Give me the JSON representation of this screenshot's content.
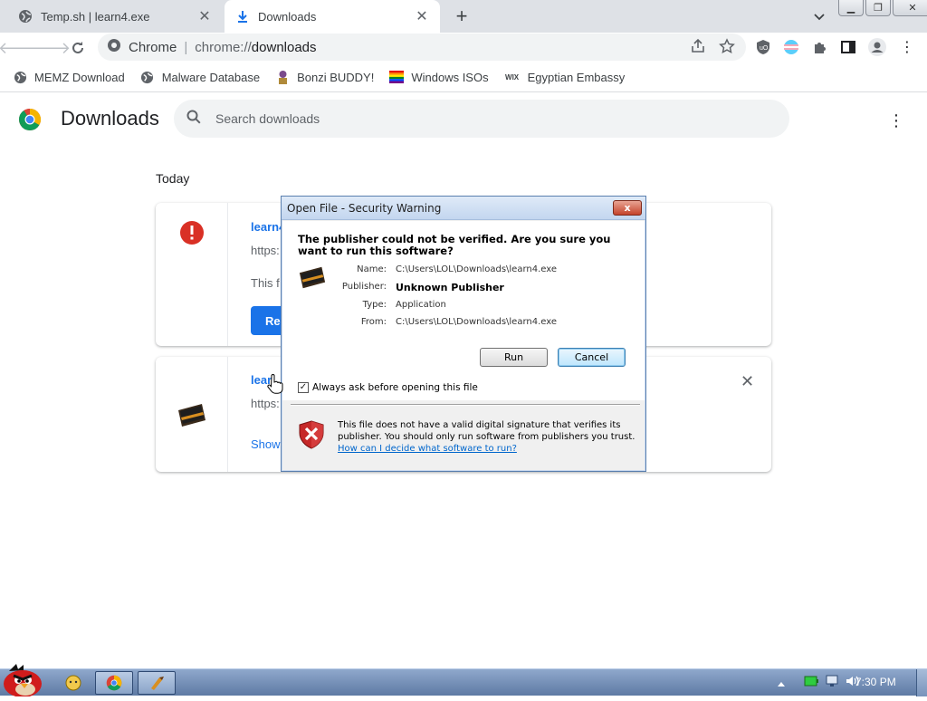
{
  "browser": {
    "tabs": [
      {
        "title": "Temp.sh | learn4.exe",
        "active": false
      },
      {
        "title": "Downloads",
        "active": true
      }
    ],
    "omnibox": {
      "site": "Chrome",
      "url_prefix": "chrome://",
      "url_host": "downloads"
    },
    "bookmarks": [
      {
        "label": "MEMZ Download",
        "icon": "globe-icon"
      },
      {
        "label": "Malware Database",
        "icon": "globe-icon"
      },
      {
        "label": "Bonzi BUDDY!",
        "icon": "bonzi-icon"
      },
      {
        "label": "Windows ISOs",
        "icon": "rainbow-flag-icon"
      },
      {
        "label": "Egyptian Embassy",
        "icon": "wix-icon"
      }
    ]
  },
  "downloads": {
    "title": "Downloads",
    "search_placeholder": "Search downloads",
    "section": "Today",
    "items": [
      {
        "name": "learn4",
        "url": "https:",
        "desc": "This f",
        "button": "Re",
        "status": "blocked"
      },
      {
        "name": "lear",
        "url": "https:",
        "link": "Show"
      }
    ]
  },
  "dialog": {
    "title": "Open File - Security Warning",
    "close": "x",
    "heading": "The publisher could not be verified.  Are you sure you want to run this software?",
    "fields": [
      {
        "label": "Name:",
        "value": "C:\\Users\\LOL\\Downloads\\learn4.exe",
        "bold": false
      },
      {
        "label": "Publisher:",
        "value": "Unknown Publisher",
        "bold": true
      },
      {
        "label": "Type:",
        "value": "Application",
        "bold": false
      },
      {
        "label": "From:",
        "value": "C:\\Users\\LOL\\Downloads\\learn4.exe",
        "bold": false
      }
    ],
    "run_label": "Run",
    "cancel_label": "Cancel",
    "checkbox_label": "Always ask before opening this file",
    "checkbox_checked": true,
    "warning_text": "This file does not have a valid digital signature that verifies its publisher.  You should only run software from publishers you trust.",
    "help_link": "How can I decide what software to run?"
  },
  "taskbar": {
    "clock": "7:30 PM"
  },
  "colors": {
    "accent": "#1a73e8",
    "error": "#d93025",
    "taskbar": "#6f8bb5"
  }
}
